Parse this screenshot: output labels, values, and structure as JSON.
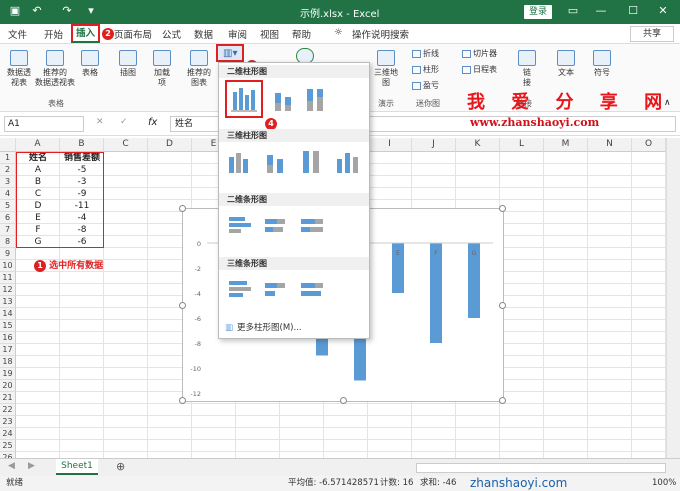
{
  "titlebar": {
    "title": "示例.xlsx - Excel",
    "login": "登录"
  },
  "menu": {
    "items": [
      "文件",
      "开始",
      "插入",
      "页面布局",
      "公式",
      "数据",
      "审阅",
      "视图",
      "帮助"
    ],
    "search": "操作说明搜索",
    "share": "共享",
    "badge_insert": "2",
    "badge_chart": "3"
  },
  "ribbon": {
    "pivot": "数据透\n视表",
    "recpivot": "推荐的\n数据透视表",
    "table": "表格",
    "group_table": "表格",
    "illust": "插图",
    "addin": "加载\n项",
    "recchart": "推荐的\n图表",
    "map3d": "三维地\n图",
    "group_demo": "演示",
    "line": "折线",
    "column": "柱形",
    "winloss": "盈亏",
    "group_spark": "迷你图",
    "slicer": "切片器",
    "timeline": "日程表",
    "link": "链\n接",
    "text": "文本",
    "symbol": "符号",
    "group_link": "链接"
  },
  "watermark": {
    "cn": "我 爱 分 享 网",
    "url": "www.zhanshaoyi.com"
  },
  "formula": {
    "namebox": "A1",
    "fx": "fx",
    "content": "姓名"
  },
  "columns": [
    "A",
    "B",
    "C",
    "D",
    "E",
    "F",
    "G",
    "H",
    "I",
    "J",
    "K",
    "L",
    "M",
    "N",
    "O"
  ],
  "rows": [
    "1",
    "2",
    "3",
    "4",
    "5",
    "6",
    "7",
    "8",
    "9",
    "10",
    "11",
    "12",
    "13",
    "14",
    "15",
    "16",
    "17",
    "18",
    "19",
    "20",
    "21",
    "22",
    "23",
    "24",
    "25",
    "26"
  ],
  "table": {
    "headers": [
      "姓名",
      "销售差额"
    ],
    "data": [
      [
        "A",
        "-5"
      ],
      [
        "B",
        "-3"
      ],
      [
        "C",
        "-9"
      ],
      [
        "D",
        "-11"
      ],
      [
        "E",
        "-4"
      ],
      [
        "F",
        "-8"
      ],
      [
        "G",
        "-6"
      ]
    ]
  },
  "annotations": {
    "step1": "1",
    "step1_text": "选中所有数据",
    "step4": "4"
  },
  "dropdown": {
    "h1": "二维柱形图",
    "h2": "三维柱形图",
    "h3": "二维条形图",
    "h4": "三维条形图",
    "more": "更多柱形图(M)..."
  },
  "chart_data": {
    "type": "bar",
    "categories": [
      "A",
      "B",
      "C",
      "D",
      "E",
      "F",
      "G"
    ],
    "values": [
      -5,
      -3,
      -9,
      -11,
      -4,
      -8,
      -6
    ],
    "ylim": [
      -12,
      0
    ],
    "yticks": [
      "0",
      "-2",
      "-4",
      "-6",
      "-8",
      "-10",
      "-12"
    ],
    "color": "#5b9bd5"
  },
  "sheet": {
    "tab": "Sheet1"
  },
  "status": {
    "left": "就绪",
    "avg": "平均值: -6.571428571",
    "count": "计数: 16",
    "sum": "求和: -46",
    "zoom": "100%",
    "wm": "zhanshaoyi.com"
  }
}
